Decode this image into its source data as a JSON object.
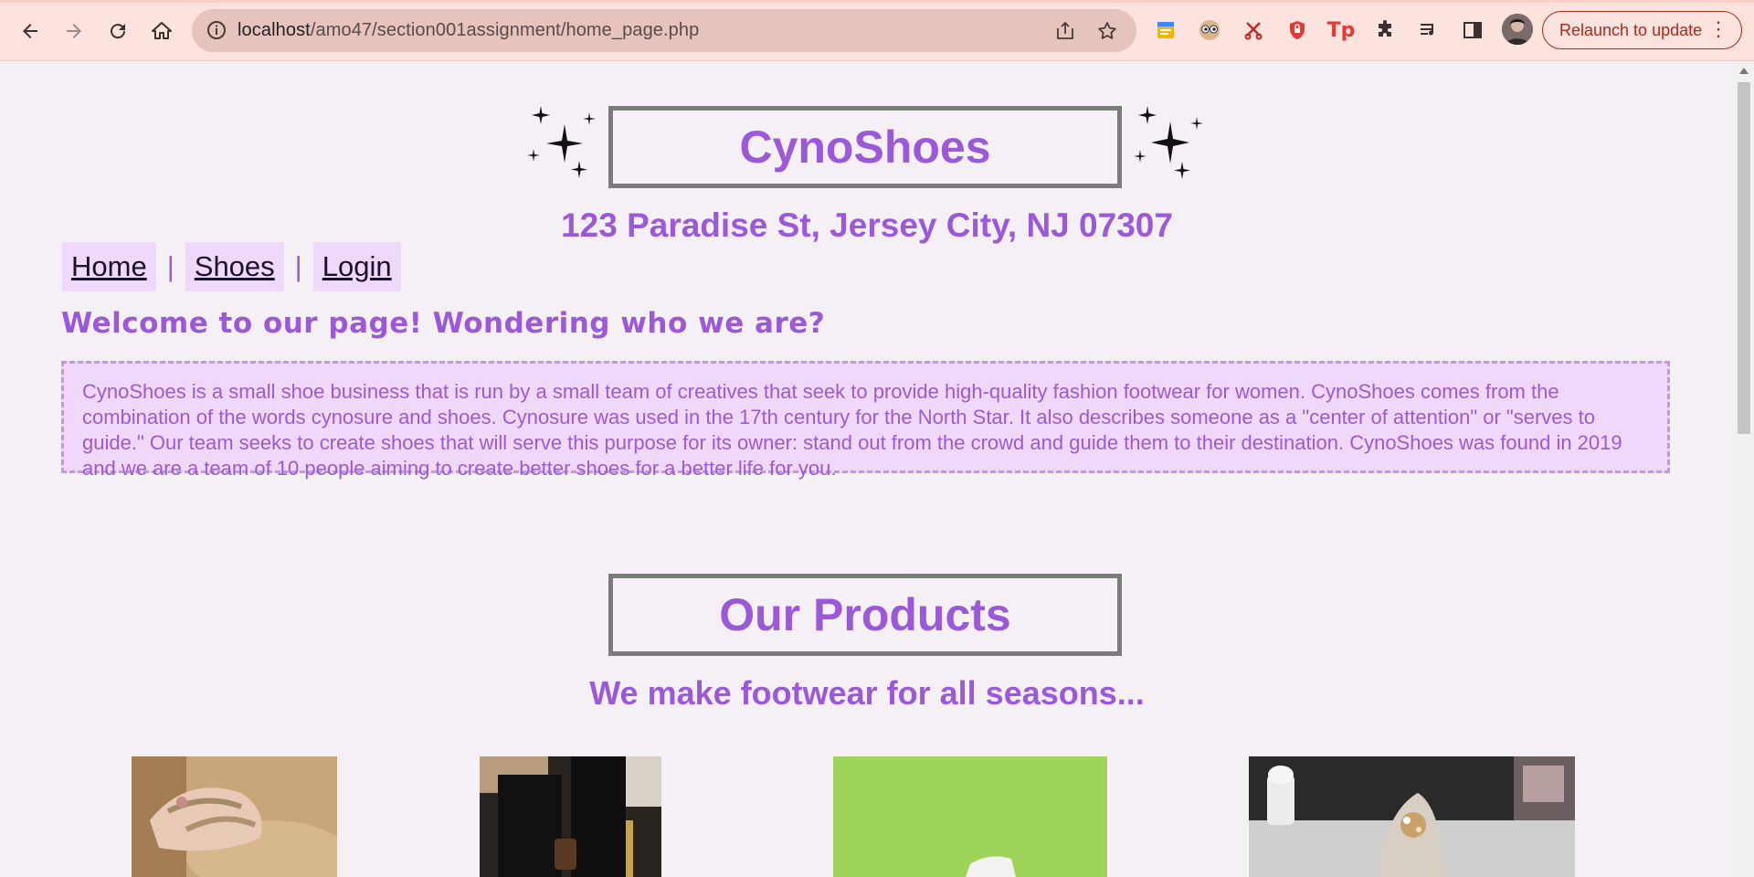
{
  "browser": {
    "url_host": "localhost",
    "url_path": "/amo47/section001assignment/home_page.php",
    "relaunch_label": "Relaunch to update",
    "icons": [
      "back-icon",
      "forward-icon",
      "reload-icon",
      "home-icon",
      "info-icon",
      "share-icon",
      "bookmark-star-icon",
      "notes-extension-icon",
      "eyes-extension-icon",
      "scissors-extension-icon",
      "shield-extension-icon",
      "tp-extension-icon",
      "puzzle-extension-icon",
      "media-list-icon",
      "side-panel-icon",
      "profile-avatar",
      "more-menu-icon"
    ],
    "tp_ext_label": "Tp"
  },
  "header": {
    "brand": "CynoShoes",
    "address": "123 Paradise St, Jersey City, NJ 07307"
  },
  "nav": {
    "items": [
      {
        "label": "Home"
      },
      {
        "label": "Shoes"
      },
      {
        "label": "Login"
      }
    ],
    "separator": "|"
  },
  "intro": {
    "heading": "Welcome to our page! Wondering who we are?",
    "body": "CynoShoes is a small shoe business that is run by a small team of creatives that seek to provide high-quality fashion footwear for women. CynoShoes comes from the combination of the words cynosure and shoes. Cynosure was used in the 17th century for the North Star. It also describes someone as a \"center of attention\" or \"serves to guide.\" Our team seeks to create shoes that will serve this purpose for its owner: stand out from the crowd and guide them to their destination. CynoShoes was found in 2019 and we are a team of 10 people aiming to create better shoes for a better life for you."
  },
  "products": {
    "heading": "Our Products",
    "tagline": "We make footwear for all seasons...",
    "images": [
      "sandal-photo",
      "thigh-high-boot-photo",
      "white-sneaker-photo",
      "embellished-flat-photo"
    ]
  },
  "colors": {
    "accent_purple": "#9b59d9",
    "panel_lilac": "#f0d8fa",
    "page_bg": "#f4f0f6",
    "chrome_bg": "#fde3dd",
    "relaunch_red": "#b3261e"
  }
}
